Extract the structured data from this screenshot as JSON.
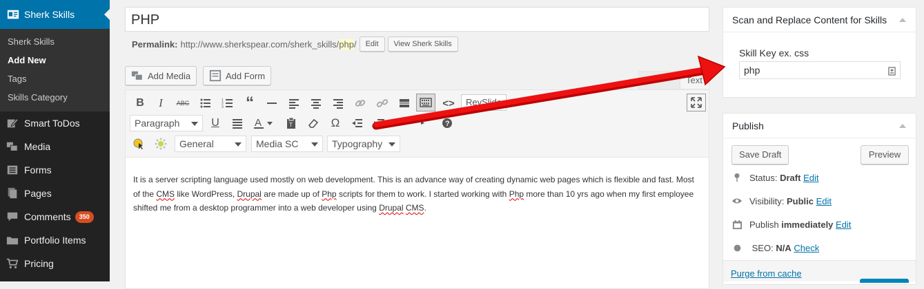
{
  "sidebar": {
    "current": "Sherk Skills",
    "submenu": [
      "Sherk Skills",
      "Add New",
      "Tags",
      "Skills Category"
    ],
    "items": [
      {
        "label": "Smart ToDos",
        "icon": "edit-icon"
      },
      {
        "label": "Media",
        "icon": "media-icon"
      },
      {
        "label": "Forms",
        "icon": "forms-icon"
      },
      {
        "label": "Pages",
        "icon": "pages-icon"
      },
      {
        "label": "Comments",
        "icon": "comment-icon",
        "badge": "350"
      },
      {
        "label": "Portfolio Items",
        "icon": "folder-icon"
      },
      {
        "label": "Pricing",
        "icon": "cart-icon"
      }
    ]
  },
  "post": {
    "title": "PHP",
    "permalink_label": "Permalink:",
    "permalink_base": "http://www.sherkspear.com/sherk_skills/",
    "permalink_slug": "php",
    "permalink_end": "/",
    "edit_label": "Edit",
    "view_label": "View Sherk Skills"
  },
  "media": {
    "add_media": "Add Media",
    "add_form": "Add Form",
    "visual_tab": "Vi",
    "text_tab": "Text"
  },
  "toolbar": {
    "revslider": "RevSlider",
    "format_select": "Paragraph",
    "general_select": "General",
    "media_sc_select": "Media SC",
    "typography_select": "Typography"
  },
  "content": {
    "p1": "It is a server scripting language used mostly on web development.  This is an advance way of creating dynamic web pages which is flexible and fast. Most of the ",
    "w1": "CMS",
    "p2": " like WordPress, ",
    "w2": "Drupal",
    "p3": " are made up of ",
    "w3": "Php",
    "p4": " scripts for them to work. I started working with ",
    "w4": "Php",
    "p5": " more than 10 yrs ago when my first employee shifted me from a desktop programmer into a web developer using ",
    "w5": "Drupal",
    "p6": " ",
    "w6": "CMS",
    "p7": "."
  },
  "scan_box": {
    "title": "Scan and Replace Content for Skills",
    "label": "Skill Key ex. css",
    "value": "php"
  },
  "publish": {
    "title": "Publish",
    "save_draft": "Save Draft",
    "preview": "Preview",
    "status_label": "Status:",
    "status_value": "Draft",
    "visibility_label": "Visibility:",
    "visibility_value": "Public",
    "publish_label": "Publish",
    "publish_value": "immediately",
    "seo_label": "SEO:",
    "seo_value": "N/A",
    "check": "Check",
    "edit": "Edit",
    "purge": "Purge from cache"
  },
  "colors": {
    "accent": "#0073aa",
    "sidebar": "#222222",
    "badge": "#d54e21",
    "arrow": "#ee1111"
  }
}
